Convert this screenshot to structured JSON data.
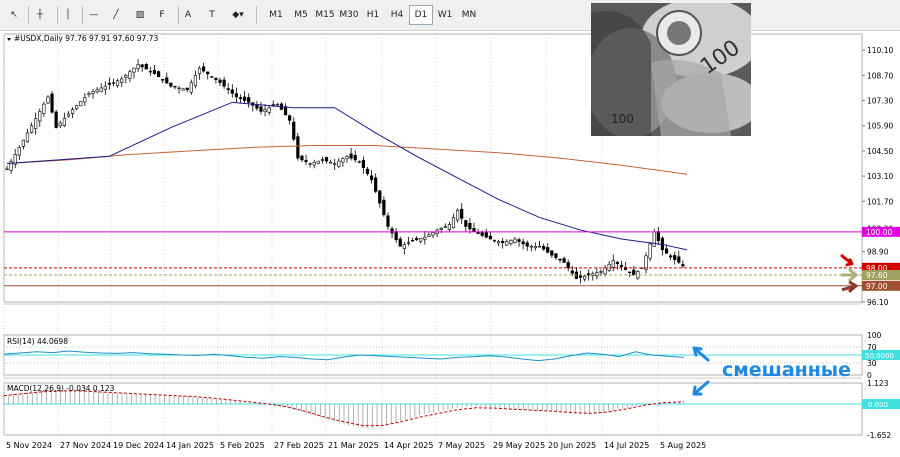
{
  "toolbar": {
    "tools": [
      {
        "name": "cursor-icon",
        "glyph": "↖"
      },
      {
        "name": "crosshair-icon",
        "glyph": "┼"
      },
      {
        "name": "vertical-line-icon",
        "glyph": "│"
      },
      {
        "name": "horizontal-line-icon",
        "glyph": "—"
      },
      {
        "name": "trendline-icon",
        "glyph": "╱"
      },
      {
        "name": "channel-icon",
        "glyph": "▧"
      },
      {
        "name": "fibo-icon",
        "glyph": "F"
      },
      {
        "name": "text-icon",
        "glyph": "A"
      },
      {
        "name": "label-icon",
        "glyph": "T"
      },
      {
        "name": "shapes-icon",
        "glyph": "◆▾"
      }
    ],
    "timeframes": [
      "M1",
      "M5",
      "M15",
      "M30",
      "H1",
      "H4",
      "D1",
      "W1",
      "MN"
    ],
    "active_timeframe": "D1"
  },
  "symbol_info": "#USDX,Daily  97.76 97.91 97.60 97.73",
  "rsi_label": "RSI(14) 44.0698",
  "macd_label": "MACD(12,26,9) -0.034 0.123",
  "annotation_text": "смешанные",
  "colors": {
    "bull": "#000000",
    "bear": "#000000",
    "ma_fast": "#1a1a8c",
    "ma_slow": "#c86432",
    "magenta": "#e000e0",
    "red_dash": "#d00000",
    "rsi": "#1e90c8",
    "aqua": "#40e0e0",
    "macd_hist": "#a0a0a0",
    "macd_signal": "#c00000",
    "annot": "#1e88e5"
  },
  "chart_data": [
    {
      "type": "candlestick",
      "title": "#USDX,Daily",
      "ylim": [
        96.1,
        111.0
      ],
      "y_ticks": [
        110.1,
        108.7,
        107.3,
        105.9,
        104.5,
        103.1,
        101.7,
        100.2,
        98.9,
        96.1
      ],
      "x_ticks": [
        "5 Nov 2024",
        "27 Nov 2024",
        "19 Dec 2024",
        "14 Jan 2025",
        "5 Feb 2025",
        "27 Feb 2025",
        "21 Mar 2025",
        "14 Apr 2025",
        "7 May 2025",
        "29 May 2025",
        "20 Jun 2025",
        "14 Jul 2025",
        "5 Aug 2025"
      ],
      "close_path": [
        [
          0,
          103.5
        ],
        [
          5,
          105.5
        ],
        [
          10,
          107.5
        ],
        [
          12,
          105.8
        ],
        [
          16,
          106.8
        ],
        [
          20,
          107.7
        ],
        [
          25,
          108.2
        ],
        [
          28,
          108.5
        ],
        [
          32,
          109.3
        ],
        [
          36,
          108.8
        ],
        [
          40,
          108.1
        ],
        [
          44,
          107.9
        ],
        [
          47,
          109.1
        ],
        [
          52,
          108.3
        ],
        [
          56,
          107.5
        ],
        [
          59,
          107.2
        ],
        [
          62,
          106.7
        ],
        [
          66,
          107.1
        ],
        [
          69,
          106.2
        ],
        [
          71,
          104.1
        ],
        [
          74,
          103.8
        ],
        [
          77,
          104.0
        ],
        [
          80,
          103.8
        ],
        [
          83,
          104.2
        ],
        [
          86,
          103.9
        ],
        [
          89,
          102.9
        ],
        [
          93,
          100.3
        ],
        [
          96,
          99.2
        ],
        [
          99,
          99.5
        ],
        [
          102,
          99.7
        ],
        [
          105,
          100.1
        ],
        [
          108,
          100.4
        ],
        [
          110,
          101.2
        ],
        [
          112,
          100.3
        ],
        [
          115,
          99.9
        ],
        [
          118,
          99.6
        ],
        [
          121,
          99.4
        ],
        [
          124,
          99.6
        ],
        [
          127,
          99.2
        ],
        [
          130,
          99.2
        ],
        [
          133,
          98.7
        ],
        [
          136,
          98.3
        ],
        [
          139,
          97.4
        ],
        [
          142,
          97.6
        ],
        [
          145,
          97.8
        ],
        [
          148,
          98.4
        ],
        [
          151,
          97.9
        ],
        [
          153,
          97.6
        ],
        [
          155,
          98.0
        ],
        [
          158,
          100.0
        ],
        [
          160,
          99.0
        ],
        [
          162,
          98.6
        ],
        [
          164,
          98.3
        ],
        [
          166,
          97.9
        ]
      ],
      "ma_fast": [
        [
          0,
          103.8
        ],
        [
          25,
          104.2
        ],
        [
          40,
          105.8
        ],
        [
          55,
          107.2
        ],
        [
          70,
          106.9
        ],
        [
          80,
          106.9
        ],
        [
          90,
          105.5
        ],
        [
          100,
          104.2
        ],
        [
          110,
          103.0
        ],
        [
          120,
          101.8
        ],
        [
          130,
          100.8
        ],
        [
          140,
          100.1
        ],
        [
          150,
          99.6
        ],
        [
          160,
          99.3
        ],
        [
          166,
          99.0
        ]
      ],
      "ma_slow": [
        [
          0,
          103.8
        ],
        [
          15,
          104.0
        ],
        [
          30,
          104.3
        ],
        [
          45,
          104.5
        ],
        [
          60,
          104.7
        ],
        [
          75,
          104.8
        ],
        [
          90,
          104.8
        ],
        [
          105,
          104.6
        ],
        [
          120,
          104.4
        ],
        [
          135,
          104.1
        ],
        [
          150,
          103.7
        ],
        [
          166,
          103.2
        ]
      ],
      "levels": [
        {
          "value": 100.0,
          "label": "100.00",
          "color": "#e000e0",
          "style": "solid"
        },
        {
          "value": 98.0,
          "label": "98.00",
          "color": "#d00000",
          "style": "dashed"
        },
        {
          "value": 97.6,
          "label": "97.60",
          "color": "#a0a060",
          "style": "dashed"
        },
        {
          "value": 97.0,
          "label": "97.00",
          "color": "#a05030",
          "style": "solid"
        }
      ]
    },
    {
      "type": "line",
      "title": "RSI(14) 44.0698",
      "ylim": [
        0,
        100
      ],
      "y_ticks": [
        100,
        70,
        30,
        0
      ],
      "level_label": "50.0000",
      "values": [
        52,
        55,
        58,
        56,
        60,
        57,
        55,
        54,
        56,
        53,
        52,
        50,
        49,
        52,
        48,
        44,
        42,
        46,
        44,
        40,
        38,
        45,
        50,
        48,
        46,
        44,
        42,
        40,
        44,
        46,
        48,
        45,
        40,
        36,
        40,
        48,
        55,
        52,
        46,
        58,
        50,
        47,
        44
      ]
    },
    {
      "type": "bar",
      "title": "MACD(12,26,9) -0.034 0.123",
      "ylim": [
        -1.652,
        1.123
      ],
      "y_ticks": [
        1.123,
        0.0,
        -1.652
      ],
      "level_label": "0.000",
      "hist": [
        0.5,
        0.6,
        0.7,
        0.75,
        0.7,
        0.65,
        0.6,
        0.55,
        0.5,
        0.45,
        0.4,
        0.3,
        0.2,
        0.1,
        0.0,
        -0.2,
        -0.5,
        -0.8,
        -1.1,
        -1.3,
        -1.2,
        -0.9,
        -0.6,
        -0.4,
        -0.2,
        -0.1,
        -0.2,
        -0.3,
        -0.35,
        -0.4,
        -0.5,
        -0.55,
        -0.4,
        -0.2,
        0.0,
        0.1,
        0.15
      ],
      "signal": [
        0.45,
        0.55,
        0.65,
        0.7,
        0.7,
        0.65,
        0.6,
        0.55,
        0.5,
        0.45,
        0.4,
        0.32,
        0.22,
        0.12,
        0.0,
        -0.15,
        -0.4,
        -0.7,
        -0.95,
        -1.15,
        -1.15,
        -0.95,
        -0.7,
        -0.5,
        -0.3,
        -0.2,
        -0.22,
        -0.28,
        -0.33,
        -0.38,
        -0.45,
        -0.5,
        -0.42,
        -0.25,
        -0.05,
        0.08,
        0.12
      ]
    }
  ]
}
